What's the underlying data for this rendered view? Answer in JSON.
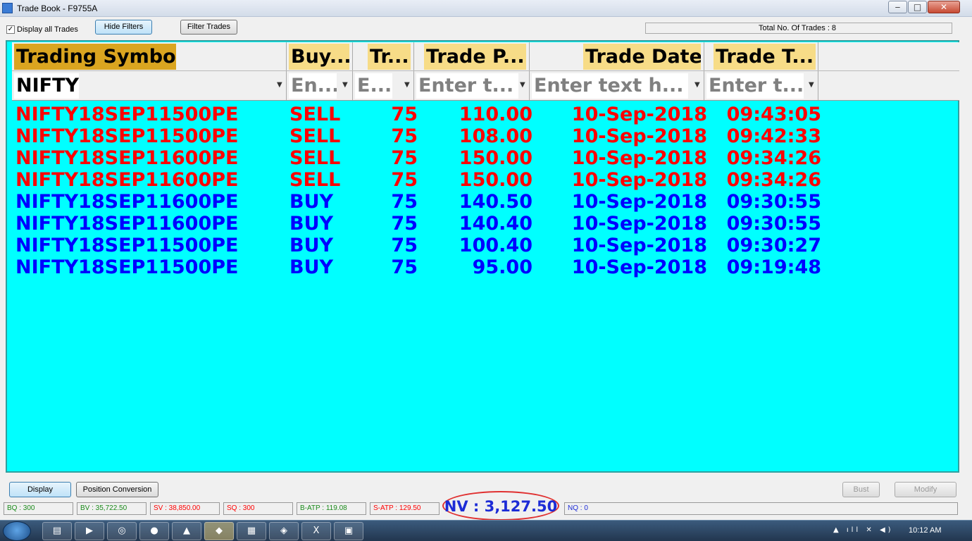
{
  "window": {
    "title": "Trade Book - F9755A",
    "controls": {
      "minimize": "‒",
      "maximize": "□",
      "close": "✕"
    }
  },
  "toolbar": {
    "display_all_checked_glyph": "✓",
    "display_all_label": "Display all Trades",
    "hide_filters": "Hide Filters",
    "filter_trades": "Filter Trades",
    "total_trades": "Total No. Of Trades : 8"
  },
  "grid": {
    "background": "#00ffff",
    "columns": [
      {
        "header": "Trading Symbol",
        "filter": "NIFTY",
        "placeholder": false
      },
      {
        "header": "Buy...",
        "filter": "En...",
        "placeholder": true
      },
      {
        "header": "Tr...",
        "filter": "E...",
        "placeholder": true
      },
      {
        "header": "Trade P...",
        "filter": "Enter t...",
        "placeholder": true
      },
      {
        "header": "Trade Date",
        "filter": "Enter text h...",
        "placeholder": true
      },
      {
        "header": "Trade T...",
        "filter": "Enter t...",
        "placeholder": true
      }
    ],
    "filter_icon": "funnel-icon",
    "rows": [
      {
        "symbol": "NIFTY18SEP11500PE",
        "side": "SELL",
        "qty": "75",
        "price": "110.00",
        "date": "10-Sep-2018",
        "time": "09:43:05",
        "color": "#ff0000"
      },
      {
        "symbol": "NIFTY18SEP11500PE",
        "side": "SELL",
        "qty": "75",
        "price": "108.00",
        "date": "10-Sep-2018",
        "time": "09:42:33",
        "color": "#ff0000"
      },
      {
        "symbol": "NIFTY18SEP11600PE",
        "side": "SELL",
        "qty": "75",
        "price": "150.00",
        "date": "10-Sep-2018",
        "time": "09:34:26",
        "color": "#ff0000"
      },
      {
        "symbol": "NIFTY18SEP11600PE",
        "side": "SELL",
        "qty": "75",
        "price": "150.00",
        "date": "10-Sep-2018",
        "time": "09:34:26",
        "color": "#ff0000"
      },
      {
        "symbol": "NIFTY18SEP11600PE",
        "side": "BUY",
        "qty": "75",
        "price": "140.50",
        "date": "10-Sep-2018",
        "time": "09:30:55",
        "color": "#0000ff"
      },
      {
        "symbol": "NIFTY18SEP11600PE",
        "side": "BUY",
        "qty": "75",
        "price": "140.40",
        "date": "10-Sep-2018",
        "time": "09:30:55",
        "color": "#0000ff"
      },
      {
        "symbol": "NIFTY18SEP11500PE",
        "side": "BUY",
        "qty": "75",
        "price": "100.40",
        "date": "10-Sep-2018",
        "time": "09:30:27",
        "color": "#0000ff"
      },
      {
        "symbol": "NIFTY18SEP11500PE",
        "side": "BUY",
        "qty": "75",
        "price": "95.00",
        "date": "10-Sep-2018",
        "time": "09:19:48",
        "color": "#0000ff"
      }
    ]
  },
  "actions": {
    "display": "Display",
    "position_conversion": "Position Conversion",
    "bust": "Bust",
    "modify": "Modify"
  },
  "status": {
    "bq": "BQ : 300",
    "bv": "BV : 35,722.50",
    "sv": "SV : 38,850.00",
    "sq": "SQ : 300",
    "batp": "B-ATP : 119.08",
    "satp": "S-ATP : 129.50",
    "nv": "NV : 3,127.50",
    "nq": "NQ : 0",
    "colors": {
      "buy": "#1a8a1a",
      "sell": "#ff0000",
      "net": "#1c2bd6"
    }
  },
  "taskbar": {
    "clock": "10:12 AM",
    "tray_glyphs": "▲ ıll ✕ ◀)"
  }
}
